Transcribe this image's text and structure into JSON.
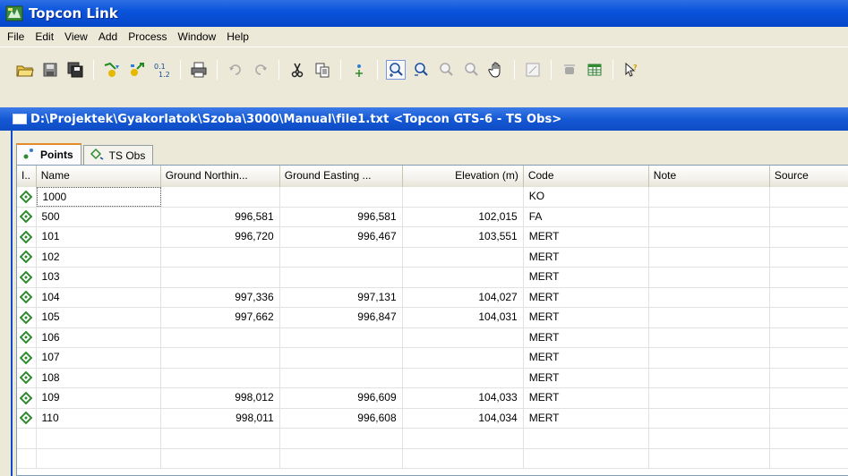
{
  "app": {
    "title": "Topcon Link"
  },
  "menu": [
    "File",
    "Edit",
    "View",
    "Add",
    "Process",
    "Window",
    "Help"
  ],
  "toolbar": {
    "icons": [
      "open-folder-icon",
      "save-icon",
      "save-all-icon",
      "import-icon",
      "export-icon",
      "convert-icon",
      "print-icon",
      "undo-icon",
      "redo-icon",
      "cut-icon",
      "copy-icon",
      "add-point-icon",
      "zoom-in-icon",
      "zoom-out-icon",
      "zoom-extents-icon",
      "zoom-window-icon",
      "pan-hand-icon",
      "select-box-icon",
      "satellite-icon",
      "table-icon",
      "help-pointer-icon"
    ]
  },
  "document": {
    "title": "D:\\Projektek\\Gyakorlatok\\Szoba\\3000\\Manual\\file1.txt  <Topcon GTS-6 - TS Obs>"
  },
  "tabs": [
    {
      "label": "Points",
      "selected": true
    },
    {
      "label": "TS Obs",
      "selected": false
    }
  ],
  "grid": {
    "columns": [
      "I..",
      "Name",
      "Ground Northin...",
      "Ground Easting ...",
      "Elevation (m)",
      "Code",
      "Note",
      "Source"
    ],
    "rows": [
      {
        "name": "1000",
        "northing": "",
        "easting": "",
        "elevation": "",
        "code": "KO",
        "note": "",
        "source": ""
      },
      {
        "name": "500",
        "northing": "996,581",
        "easting": "996,581",
        "elevation": "102,015",
        "code": "FA",
        "note": "",
        "source": ""
      },
      {
        "name": "101",
        "northing": "996,720",
        "easting": "996,467",
        "elevation": "103,551",
        "code": "MERT",
        "note": "",
        "source": ""
      },
      {
        "name": "102",
        "northing": "",
        "easting": "",
        "elevation": "",
        "code": "MERT",
        "note": "",
        "source": ""
      },
      {
        "name": "103",
        "northing": "",
        "easting": "",
        "elevation": "",
        "code": "MERT",
        "note": "",
        "source": ""
      },
      {
        "name": "104",
        "northing": "997,336",
        "easting": "997,131",
        "elevation": "104,027",
        "code": "MERT",
        "note": "",
        "source": ""
      },
      {
        "name": "105",
        "northing": "997,662",
        "easting": "996,847",
        "elevation": "104,031",
        "code": "MERT",
        "note": "",
        "source": ""
      },
      {
        "name": "106",
        "northing": "",
        "easting": "",
        "elevation": "",
        "code": "MERT",
        "note": "",
        "source": ""
      },
      {
        "name": "107",
        "northing": "",
        "easting": "",
        "elevation": "",
        "code": "MERT",
        "note": "",
        "source": ""
      },
      {
        "name": "108",
        "northing": "",
        "easting": "",
        "elevation": "",
        "code": "MERT",
        "note": "",
        "source": ""
      },
      {
        "name": "109",
        "northing": "998,012",
        "easting": "996,609",
        "elevation": "104,033",
        "code": "MERT",
        "note": "",
        "source": ""
      },
      {
        "name": "110",
        "northing": "998,011",
        "easting": "996,608",
        "elevation": "104,034",
        "code": "MERT",
        "note": "",
        "source": ""
      }
    ]
  },
  "colors": {
    "titlebar": "#0a54dc",
    "point_icon": "#2e8b2e",
    "tab_accent": "#e68b2c"
  }
}
